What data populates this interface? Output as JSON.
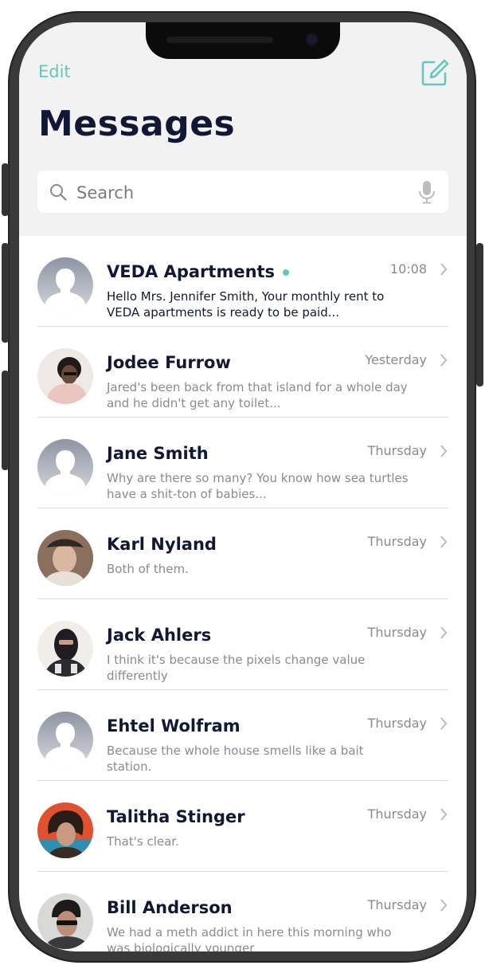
{
  "header": {
    "edit_label": "Edit",
    "compose_icon": "compose-icon",
    "title": "Messages",
    "search_placeholder": "Search",
    "search_icon": "search-icon",
    "mic_icon": "mic-icon"
  },
  "colors": {
    "accent": "#66c6bd",
    "title": "#121833",
    "muted": "#8b8b8b",
    "header_bg": "#f2f2f2"
  },
  "conversations": [
    {
      "name": "VEDA Apartments",
      "time": "10:08",
      "unread": true,
      "avatar": "placeholder",
      "preview": "Hello Mrs. Jennifer Smith, Your monthly rent to VEDA apartments is ready to be paid..."
    },
    {
      "name": "Jodee Furrow",
      "time": "Yesterday",
      "unread": false,
      "avatar": "photo",
      "preview": "Jared's been back from that island for a whole day and he didn't get any toilet..."
    },
    {
      "name": "Jane Smith",
      "time": "Thursday",
      "unread": false,
      "avatar": "placeholder",
      "preview": "Why are there so many? You know how sea turtles have a shit-ton of babies..."
    },
    {
      "name": "Karl Nyland",
      "time": "Thursday",
      "unread": false,
      "avatar": "photo",
      "preview": "Both of them."
    },
    {
      "name": "Jack Ahlers",
      "time": "Thursday",
      "unread": false,
      "avatar": "photo",
      "preview": "I think it's because the pixels change value differently"
    },
    {
      "name": "Ehtel Wolfram",
      "time": "Thursday",
      "unread": false,
      "avatar": "placeholder",
      "preview": "Because the whole house smells like a bait station."
    },
    {
      "name": "Talitha Stinger",
      "time": "Thursday",
      "unread": false,
      "avatar": "photo",
      "preview": "That's clear."
    },
    {
      "name": "Bill Anderson",
      "time": "Thursday",
      "unread": false,
      "avatar": "photo",
      "preview": "We had a meth addict in here this morning who was biologically younger"
    }
  ]
}
